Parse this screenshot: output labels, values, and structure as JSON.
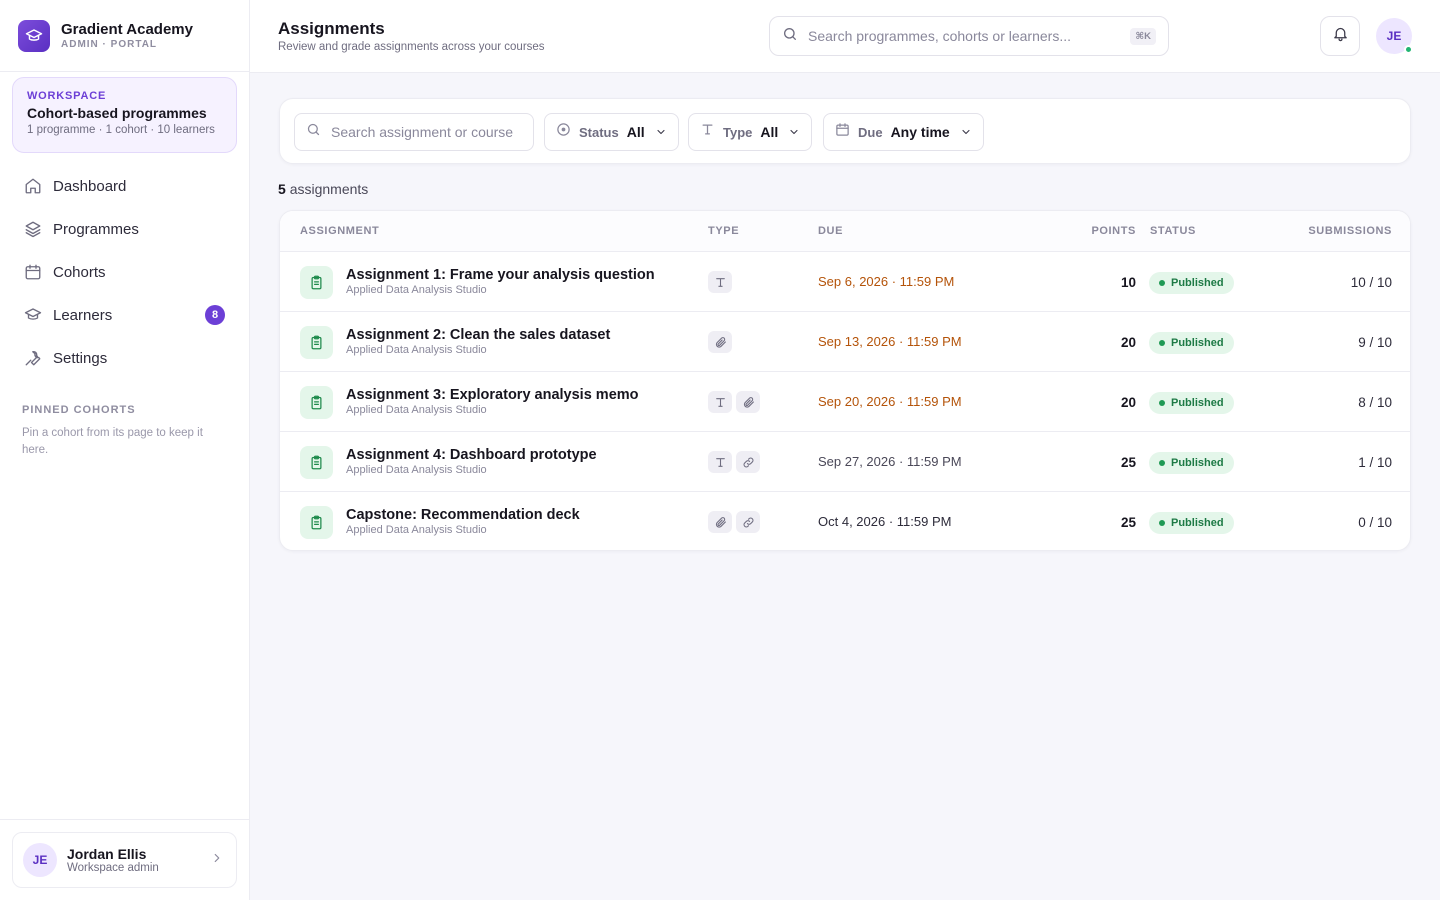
{
  "brand": {
    "name": "Gradient Academy",
    "subtitle": "ADMIN · PORTAL",
    "logo_icon": "graduation-cap-icon"
  },
  "workspace": {
    "kicker": "WORKSPACE",
    "title": "Cohort-based programmes",
    "meta": "1 programme · 1 cohort · 10 learners"
  },
  "nav": {
    "items": [
      {
        "label": "Dashboard",
        "icon": "home-icon"
      },
      {
        "label": "Programmes",
        "icon": "layers-icon"
      },
      {
        "label": "Cohorts",
        "icon": "calendar-icon"
      },
      {
        "label": "Learners",
        "icon": "graduation-cap-icon",
        "badge": "8"
      },
      {
        "label": "Settings",
        "icon": "wrench-icon"
      }
    ]
  },
  "pinned": {
    "title": "PINNED COHORTS",
    "text": "Pin a cohort from its page to keep it here."
  },
  "user": {
    "initials": "JE",
    "name": "Jordan Ellis",
    "role": "Workspace admin"
  },
  "header": {
    "title": "Assignments",
    "subtitle": "Review and grade assignments across your courses",
    "search_placeholder": "Search programmes, cohorts or learners...",
    "shortcut": "⌘K",
    "avatar_initials": "JE"
  },
  "filters": {
    "search_placeholder": "Search assignment or course",
    "status": {
      "key": "Status",
      "value": "All"
    },
    "type": {
      "key": "Type",
      "value": "All"
    },
    "due": {
      "key": "Due",
      "value": "Any time"
    }
  },
  "summary": {
    "count": "5",
    "label": "assignments"
  },
  "table": {
    "columns": {
      "assignment": "ASSIGNMENT",
      "type": "TYPE",
      "due": "DUE",
      "points": "POINTS",
      "status": "STATUS",
      "submissions": "SUBMISSIONS"
    },
    "rows": [
      {
        "title": "Assignment 1: Frame your analysis question",
        "course": "Applied Data Analysis Studio",
        "types": [
          "text"
        ],
        "due": "Sep 6, 2026 · 11:59 PM",
        "due_color": "#b45309",
        "points": "10",
        "status": "Published",
        "submissions": "10 / 10"
      },
      {
        "title": "Assignment 2: Clean the sales dataset",
        "course": "Applied Data Analysis Studio",
        "types": [
          "file"
        ],
        "due": "Sep 13, 2026 · 11:59 PM",
        "due_color": "#b45309",
        "points": "20",
        "status": "Published",
        "submissions": "9 / 10"
      },
      {
        "title": "Assignment 3: Exploratory analysis memo",
        "course": "Applied Data Analysis Studio",
        "types": [
          "text",
          "file"
        ],
        "due": "Sep 20, 2026 · 11:59 PM",
        "due_color": "#b45309",
        "points": "20",
        "status": "Published",
        "submissions": "8 / 10"
      },
      {
        "title": "Assignment 4: Dashboard prototype",
        "course": "Applied Data Analysis Studio",
        "types": [
          "text",
          "link"
        ],
        "due": "Sep 27, 2026 · 11:59 PM",
        "due_color": "#4a4858",
        "points": "25",
        "status": "Published",
        "submissions": "1 / 10"
      },
      {
        "title": "Capstone: Recommendation deck",
        "course": "Applied Data Analysis Studio",
        "types": [
          "file",
          "link"
        ],
        "due": "Oct 4, 2026 · 11:59 PM",
        "due_color": "#2d2b3a",
        "points": "25",
        "status": "Published",
        "submissions": "0 / 10"
      }
    ]
  },
  "colors": {
    "accent": "#6c3fd6",
    "published_bg": "#e4f6ea",
    "published_text": "#1d7a45",
    "due_soon": "#b45309"
  }
}
